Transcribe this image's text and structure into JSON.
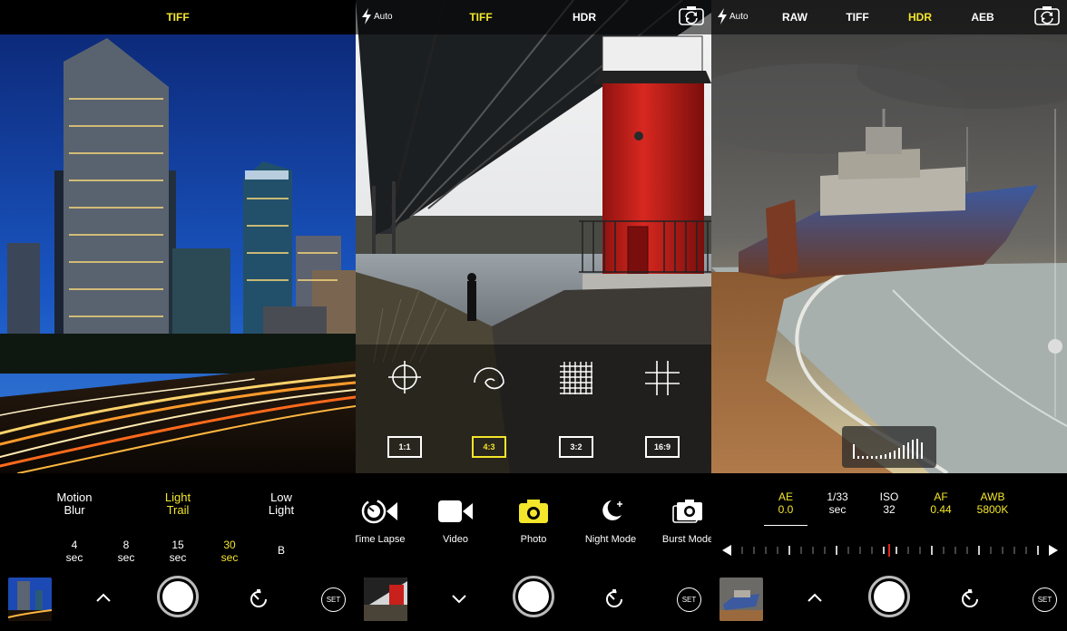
{
  "panel1": {
    "top_label": "TIFF",
    "modes": [
      {
        "line1": "Motion",
        "line2": "Blur",
        "selected": false
      },
      {
        "line1": "Light",
        "line2": "Trail",
        "selected": true
      },
      {
        "line1": "Low",
        "line2": "Light",
        "selected": false
      }
    ],
    "durations": [
      {
        "value": "4",
        "unit": "sec",
        "selected": false
      },
      {
        "value": "8",
        "unit": "sec",
        "selected": false
      },
      {
        "value": "15",
        "unit": "sec",
        "selected": false
      },
      {
        "value": "30",
        "unit": "sec",
        "selected": true
      },
      {
        "value": "B",
        "unit": "",
        "selected": false
      }
    ],
    "set_label": "SET",
    "icons": [
      "chevron-up-icon",
      "timer-icon"
    ]
  },
  "panel2": {
    "flash_label": "Auto",
    "top_tabs": [
      {
        "label": "TIFF",
        "selected": true
      },
      {
        "label": "HDR",
        "selected": false
      }
    ],
    "grid_icons": [
      "crosshair-icon",
      "golden-spiral-icon",
      "grid-dense-icon",
      "grid-thirds-icon"
    ],
    "aspect_ratios": [
      {
        "label": "1:1",
        "selected": false
      },
      {
        "label": "4:3",
        "selected": true
      },
      {
        "label": "3:2",
        "selected": false
      },
      {
        "label": "16:9",
        "selected": false
      }
    ],
    "camera_modes": [
      {
        "label": "Time Lapse",
        "icon": "time-lapse-icon",
        "selected": false
      },
      {
        "label": "Video",
        "icon": "video-icon",
        "selected": false
      },
      {
        "label": "Photo",
        "icon": "camera-icon",
        "selected": true
      },
      {
        "label": "Night Mode",
        "icon": "night-mode-icon",
        "selected": false
      },
      {
        "label": "Burst Mode",
        "icon": "burst-mode-icon",
        "selected": false
      }
    ],
    "set_label": "SET"
  },
  "panel3": {
    "flash_label": "Auto",
    "top_tabs": [
      {
        "label": "RAW",
        "selected": false
      },
      {
        "label": "TIFF",
        "selected": false
      },
      {
        "label": "HDR",
        "selected": true
      },
      {
        "label": "AEB",
        "selected": false
      }
    ],
    "params": [
      {
        "name": "AE",
        "value": "0.0",
        "active": true
      },
      {
        "name": "1/33",
        "value": "sec",
        "active": false
      },
      {
        "name": "ISO",
        "value": "32",
        "active": false
      },
      {
        "name": "AF",
        "value": "0.44",
        "active": true
      },
      {
        "name": "AWB",
        "value": "5800K",
        "active": true
      }
    ],
    "set_label": "SET",
    "colors": {
      "accent_yellow": "#f4e62b",
      "ruler_marker_red": "#e0231c"
    }
  }
}
